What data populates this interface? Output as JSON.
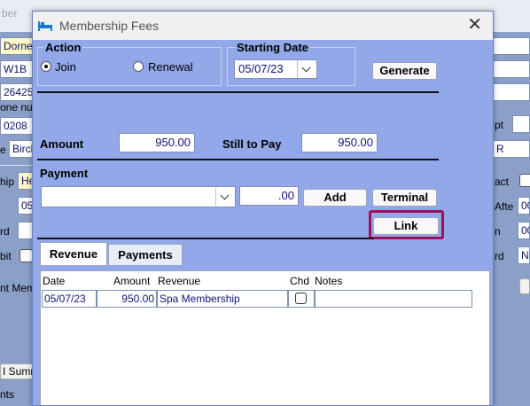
{
  "background": {
    "title_fragment": "ber",
    "fields_left": [
      "Dorne",
      "W1B",
      "26425",
      "0208",
      "Birch",
      "He",
      "05"
    ],
    "labels_left": [
      "one nur",
      "e",
      "hip",
      "rd",
      "bit",
      "nt Mem",
      "I Summ",
      "nts"
    ],
    "labels_right": [
      "pt",
      "act",
      "Afte",
      "n",
      "rd"
    ],
    "fields_right": [
      "R",
      "00",
      "00",
      "No"
    ]
  },
  "dialog": {
    "title": "Membership Fees",
    "close_glyph": "✕",
    "action": {
      "title": "Action",
      "join_label": "Join",
      "renewal_label": "Renewal",
      "selected": "Join"
    },
    "starting_date": {
      "title": "Starting Date",
      "value": "05/07/23"
    },
    "generate_label": "Generate",
    "amount_label": "Amount",
    "amount_value": "950.00",
    "still_to_pay_label": "Still to Pay",
    "still_to_pay_value": "950.00",
    "payment_label": "Payment",
    "payment_method_value": "",
    "payment_amount_value": ".00",
    "add_label": "Add",
    "terminal_label": "Terminal",
    "link_label": "Link",
    "tabs": [
      {
        "label": "Revenue",
        "active": true
      },
      {
        "label": "Payments",
        "active": false
      }
    ],
    "grid": {
      "headers": {
        "date": "Date",
        "amount": "Amount",
        "revenue": "Revenue",
        "chd": "Chd",
        "notes": "Notes"
      },
      "rows": [
        {
          "date": "05/07/23",
          "amount": "950.00",
          "revenue": "Spa Membership",
          "chd": false,
          "notes": ""
        }
      ]
    }
  },
  "colors": {
    "dialog_bg": "#93a8e8",
    "link_highlight": "#a0105a",
    "field_text": "#10107a"
  }
}
